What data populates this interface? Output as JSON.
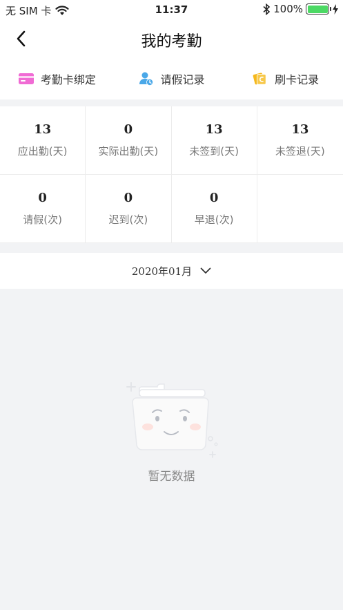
{
  "status_bar": {
    "carrier": "无 SIM 卡",
    "time": "11:37",
    "battery": "100%",
    "battery_level": 1.0,
    "icons": [
      "wifi-icon",
      "bluetooth-icon",
      "battery-icon",
      "charging-icon"
    ]
  },
  "nav": {
    "title": "我的考勤",
    "back_icon": "chevron-left-icon"
  },
  "quick_actions": [
    {
      "label": "考勤卡绑定",
      "icon": "card-icon",
      "color": "#f06bd4"
    },
    {
      "label": "请假记录",
      "icon": "user-clock-icon",
      "color": "#4aa8e8"
    },
    {
      "label": "刷卡记录",
      "icon": "swipe-card-icon",
      "color": "#f5b81c"
    }
  ],
  "stats": [
    {
      "value": "13",
      "label": "应出勤(天)"
    },
    {
      "value": "0",
      "label": "实际出勤(天)"
    },
    {
      "value": "13",
      "label": "未签到(天)"
    },
    {
      "value": "13",
      "label": "未签退(天)"
    },
    {
      "value": "0",
      "label": "请假(次)"
    },
    {
      "value": "0",
      "label": "迟到(次)"
    },
    {
      "value": "0",
      "label": "早退(次)"
    }
  ],
  "month_selector": {
    "label": "2020年01月",
    "icon": "chevron-down-icon"
  },
  "empty_state": {
    "message": "暂无数据",
    "icon": "empty-folder-icon"
  }
}
